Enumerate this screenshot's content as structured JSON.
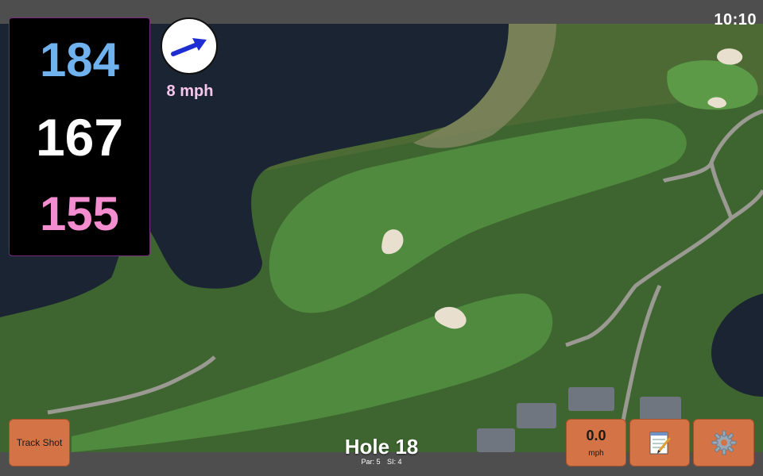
{
  "header": {
    "clock": "10:10"
  },
  "distances": {
    "back": "184",
    "middle": "167",
    "front": "155"
  },
  "wind": {
    "speed_label": "8 mph",
    "direction": "east-northeast"
  },
  "hole": {
    "title": "Hole 18",
    "par_label": "Par: 5",
    "si_label": "SI: 4"
  },
  "toolbar": {
    "track_shot_label": "Track Shot",
    "speed_value": "0.0",
    "speed_unit": "mph",
    "notes_icon": "notepad-icon",
    "settings_icon": "gear-icon"
  },
  "colors": {
    "back_distance": "#6fb2ee",
    "middle_distance": "#ffffff",
    "front_distance": "#f48dcf",
    "wind_label": "#f7c6ec",
    "button_orange": "#d47345",
    "water": "#1b2432",
    "fairway": "#3e7a34"
  }
}
